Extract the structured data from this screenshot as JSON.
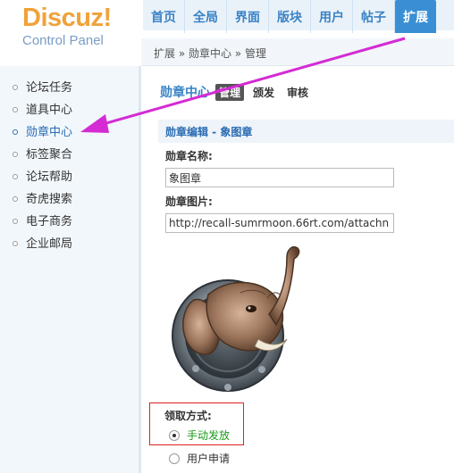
{
  "logo": {
    "brand": "Discuz!",
    "subtitle": "Control Panel"
  },
  "nav": {
    "items": [
      {
        "label": "首页"
      },
      {
        "label": "全局"
      },
      {
        "label": "界面"
      },
      {
        "label": "版块"
      },
      {
        "label": "用户"
      },
      {
        "label": "帖子"
      },
      {
        "label": "扩展"
      }
    ],
    "active_index": 6
  },
  "breadcrumb": "扩展 » 勋章中心 » 管理",
  "sidebar": {
    "items": [
      {
        "label": "论坛任务"
      },
      {
        "label": "道具中心"
      },
      {
        "label": "勋章中心"
      },
      {
        "label": "标签聚合"
      },
      {
        "label": "论坛帮助"
      },
      {
        "label": "奇虎搜索"
      },
      {
        "label": "电子商务"
      },
      {
        "label": "企业邮局"
      }
    ],
    "active_index": 2
  },
  "main": {
    "title": "勋章中心",
    "tabs": [
      {
        "label": "管理"
      },
      {
        "label": "颁发"
      },
      {
        "label": "审核"
      }
    ],
    "active_tab": 0,
    "section_title": "勋章编辑 - 象图章",
    "name_label": "勋章名称:",
    "name_value": "象图章",
    "image_label": "勋章图片:",
    "image_value": "http://recall-sumrmoon.66rt.com/attachn",
    "method_label": "领取方式:",
    "options": [
      {
        "label": "手动发放",
        "checked": true
      },
      {
        "label": "用户申请",
        "checked": false
      }
    ]
  },
  "colors": {
    "accent": "#3a8fd4",
    "arrow": "#d42bd4",
    "highlight_box": "#dd2222",
    "selected_option": "#1a9a1a"
  }
}
